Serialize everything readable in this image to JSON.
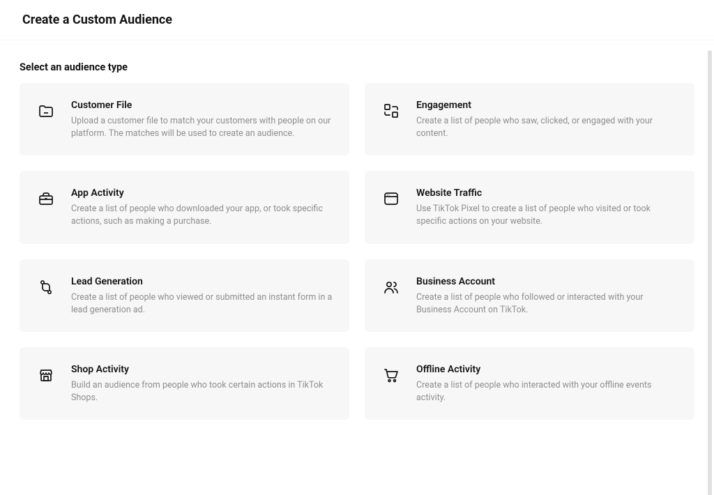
{
  "page_title": "Create a Custom Audience",
  "section_title": "Select an audience type",
  "options": [
    {
      "icon": "folder-icon",
      "title": "Customer File",
      "desc": "Upload a customer file to match your customers with people on our platform. The matches will be used to create an audience."
    },
    {
      "icon": "engagement-icon",
      "title": "Engagement",
      "desc": "Create a list of people who saw, clicked, or engaged with your content."
    },
    {
      "icon": "briefcase-icon",
      "title": "App Activity",
      "desc": "Create a list of people who downloaded your app, or took specific actions, such as making a purchase."
    },
    {
      "icon": "browser-icon",
      "title": "Website Traffic",
      "desc": "Use TikTok Pixel to create a list of people who visited or took specific actions on your website."
    },
    {
      "icon": "funnel-icon",
      "title": "Lead Generation",
      "desc": "Create a list of people who viewed or submitted an instant form in a lead generation ad."
    },
    {
      "icon": "people-icon",
      "title": "Business Account",
      "desc": "Create a list of people who followed or interacted with your Business Account on TikTok."
    },
    {
      "icon": "shop-icon",
      "title": "Shop Activity",
      "desc": "Build an audience from people who took certain actions in TikTok Shops."
    },
    {
      "icon": "cart-icon",
      "title": "Offline Activity",
      "desc": "Create a list of people who interacted with your offline events activity."
    }
  ]
}
